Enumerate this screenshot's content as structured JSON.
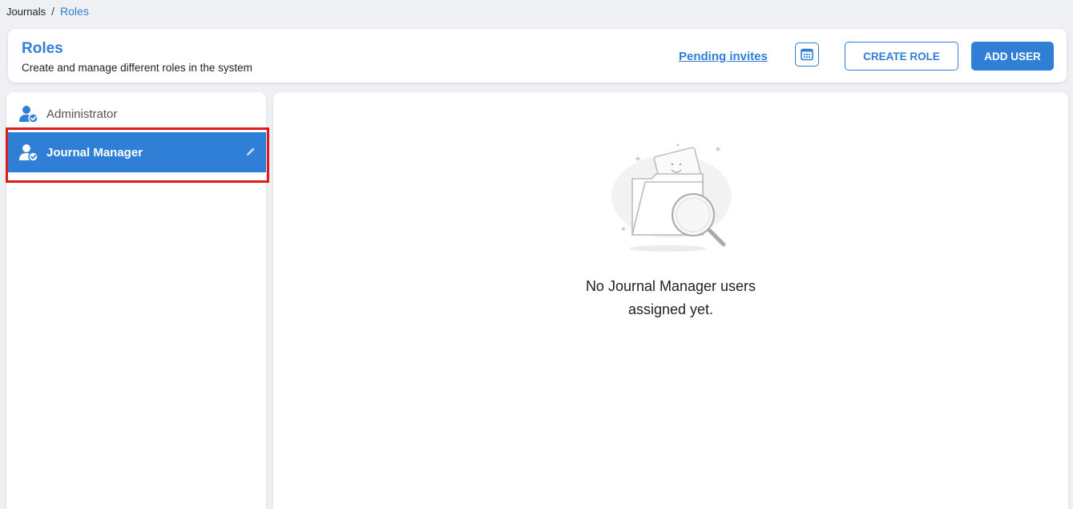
{
  "breadcrumb": {
    "root": "Journals",
    "separator": "/",
    "current": "Roles"
  },
  "header": {
    "title": "Roles",
    "subtitle": "Create and manage different roles in the system",
    "pending_invites": "Pending invites",
    "calendar_icon": "calendar-grid-icon",
    "create_role": "CREATE ROLE",
    "add_user": "ADD USER"
  },
  "sidebar": {
    "items": [
      {
        "label": "Administrator",
        "icon": "user-check-icon",
        "active": false
      },
      {
        "label": "Journal Manager",
        "icon": "user-check-icon",
        "active": true,
        "action_icon": "pencil-icon"
      }
    ]
  },
  "empty_state": {
    "illustration": "empty-folder-search-illustration",
    "line1": "No Journal Manager users",
    "line2": "assigned yet."
  },
  "colors": {
    "accent": "#2f7fd6",
    "highlight": "#e01b1b",
    "background": "#eef0f3"
  }
}
